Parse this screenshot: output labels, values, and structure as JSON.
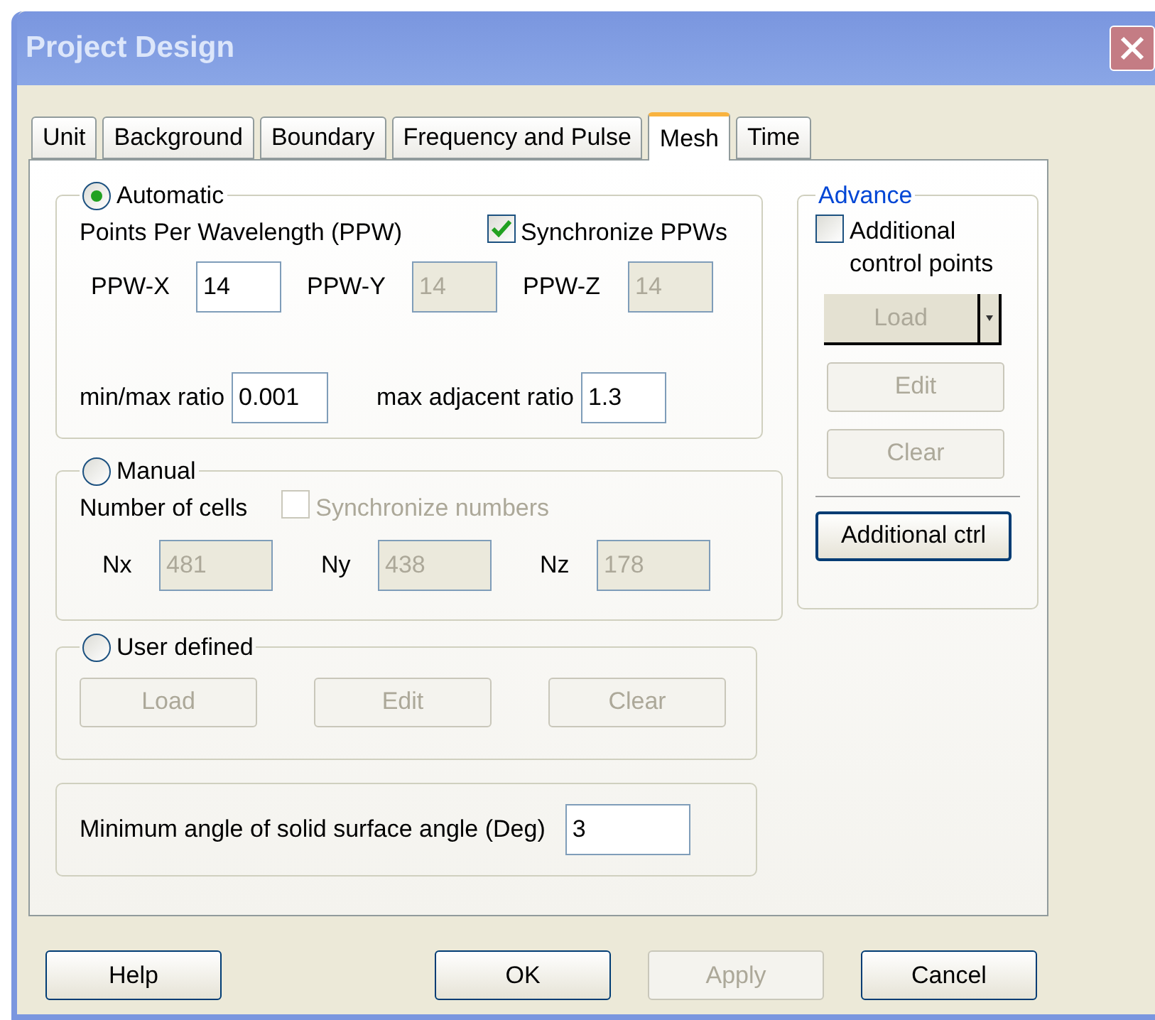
{
  "window": {
    "title": "Project Design"
  },
  "tabs": [
    {
      "label": "Unit",
      "selected": false
    },
    {
      "label": "Background",
      "selected": false
    },
    {
      "label": "Boundary",
      "selected": false
    },
    {
      "label": "Frequency and Pulse",
      "selected": false
    },
    {
      "label": "Mesh",
      "selected": true
    },
    {
      "label": "Time",
      "selected": false
    }
  ],
  "automatic": {
    "label": "Automatic",
    "selected": true,
    "ppw_label": "Points Per Wavelength (PPW)",
    "synchronize": {
      "label": "Synchronize PPWs",
      "checked": true,
      "disabled": false
    },
    "fields": [
      {
        "label": "PPW-X",
        "value": "14",
        "disabled": false
      },
      {
        "label": "PPW-Y",
        "value": "14",
        "disabled": true
      },
      {
        "label": "PPW-Z",
        "value": "14",
        "disabled": true
      }
    ],
    "ratios": [
      {
        "label": "min/max ratio",
        "value": "0.001"
      },
      {
        "label": "max adjacent ratio",
        "value": "1.3"
      }
    ]
  },
  "manual": {
    "label": "Manual",
    "selected": false,
    "cells_label": "Number of cells",
    "synchronize": {
      "label": "Synchronize numbers",
      "checked": false,
      "disabled": true
    },
    "fields": [
      {
        "label": "Nx",
        "value": "481",
        "disabled": true
      },
      {
        "label": "Ny",
        "value": "438",
        "disabled": true
      },
      {
        "label": "Nz",
        "value": "178",
        "disabled": true
      }
    ]
  },
  "user_defined": {
    "label": "User defined",
    "selected": false,
    "buttons": [
      {
        "label": "Load",
        "disabled": true
      },
      {
        "label": "Edit",
        "disabled": true
      },
      {
        "label": "Clear",
        "disabled": true
      }
    ]
  },
  "min_angle": {
    "label": "Minimum angle of solid surface angle (Deg)",
    "value": "3"
  },
  "advance": {
    "title": "Advance",
    "additional_points": {
      "label": "Additional control points",
      "checked": false,
      "disabled": false
    },
    "load": {
      "label": "Load",
      "disabled": true
    },
    "buttons": [
      {
        "label": "Edit",
        "disabled": true
      },
      {
        "label": "Clear",
        "disabled": true
      }
    ],
    "additional_ctrl": {
      "label": "Additional ctrl",
      "disabled": false
    }
  },
  "footer_buttons": [
    {
      "label": "Help",
      "disabled": false
    },
    {
      "label": "OK",
      "disabled": false
    },
    {
      "label": "Apply",
      "disabled": true
    },
    {
      "label": "Cancel",
      "disabled": false
    }
  ]
}
